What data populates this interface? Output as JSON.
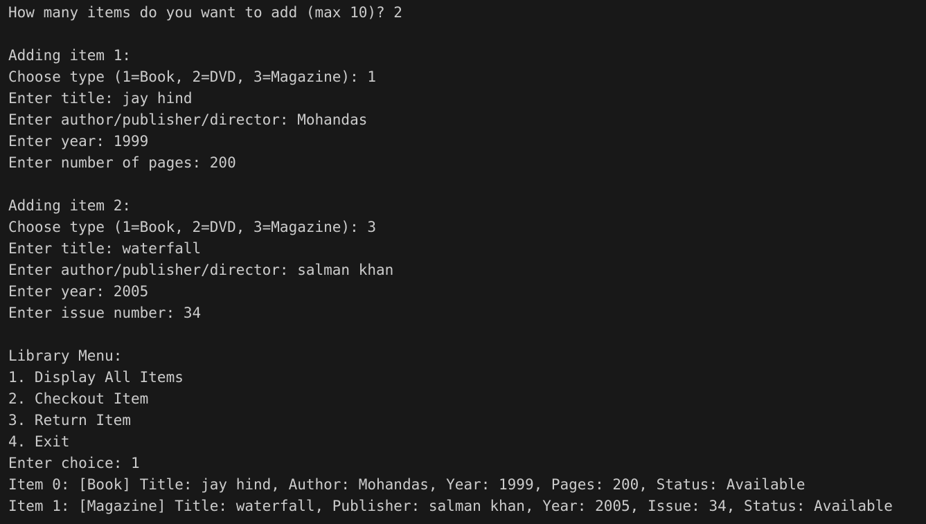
{
  "terminal": {
    "lines": [
      "How many items do you want to add (max 10)? 2",
      "",
      "Adding item 1:",
      "Choose type (1=Book, 2=DVD, 3=Magazine): 1",
      "Enter title: jay hind",
      "Enter author/publisher/director: Mohandas",
      "Enter year: 1999",
      "Enter number of pages: 200",
      "",
      "Adding item 2:",
      "Choose type (1=Book, 2=DVD, 3=Magazine): 3",
      "Enter title: waterfall",
      "Enter author/publisher/director: salman khan",
      "Enter year: 2005",
      "Enter issue number: 34",
      "",
      "Library Menu:",
      "1. Display All Items",
      "2. Checkout Item",
      "3. Return Item",
      "4. Exit",
      "Enter choice: 1",
      "Item 0: [Book] Title: jay hind, Author: Mohandas, Year: 1999, Pages: 200, Status: Available",
      "Item 1: [Magazine] Title: waterfall, Publisher: salman khan, Year: 2005, Issue: 34, Status: Available"
    ]
  }
}
